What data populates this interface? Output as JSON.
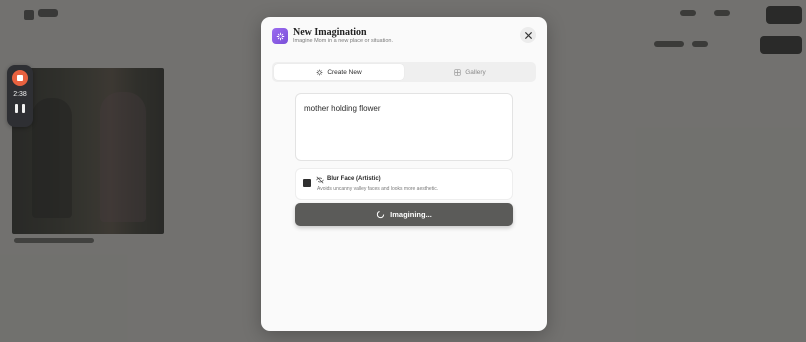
{
  "recorder": {
    "elapsed": "2:38"
  },
  "modal": {
    "title": "New Imagination",
    "subtitle": "Imagine Mom in a new place or situation."
  },
  "tabs": [
    {
      "label": "Create New",
      "icon": "sparkles-icon",
      "active": true
    },
    {
      "label": "Gallery",
      "icon": "grid-icon",
      "active": false
    }
  ],
  "prompt": {
    "value": "mother holding flower"
  },
  "blur_face": {
    "title": "Blur Face (Artistic)",
    "description": "Avoids uncanny valley faces and looks more aesthetic.",
    "checked": true
  },
  "submit": {
    "label": "Imagining...",
    "state": "loading"
  },
  "colors": {
    "accent": "#8b5cf6",
    "recorder_stop": "#e8613f",
    "button_bg": "#5b5b59"
  }
}
